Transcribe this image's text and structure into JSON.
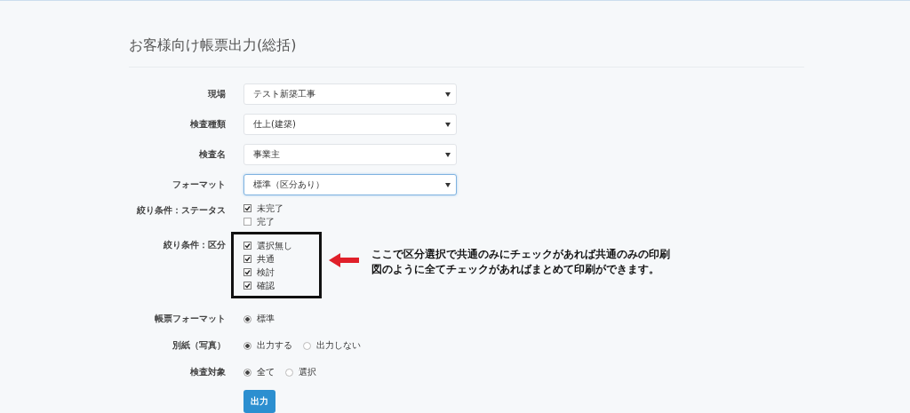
{
  "title": "お客様向け帳票出力(総括)",
  "fields": [
    {
      "kind": "select",
      "label": "現場",
      "value": "テスト新築工事",
      "focused": false
    },
    {
      "kind": "select",
      "label": "検査種類",
      "value": "仕上(建築)",
      "focused": false
    },
    {
      "kind": "select",
      "label": "検査名",
      "value": "事業主",
      "focused": false
    },
    {
      "kind": "select",
      "label": "フォーマット",
      "value": "標準（区分あり）",
      "focused": true
    },
    {
      "kind": "checkboxes",
      "label": "絞り条件：ステータス",
      "highlighted": false,
      "options": [
        {
          "label": "未完了",
          "checked": true
        },
        {
          "label": "完了",
          "checked": false
        }
      ]
    },
    {
      "kind": "checkboxes",
      "label": "絞り条件：区分",
      "highlighted": true,
      "options": [
        {
          "label": "選択無し",
          "checked": true
        },
        {
          "label": "共通",
          "checked": true
        },
        {
          "label": "検討",
          "checked": true
        },
        {
          "label": "確認",
          "checked": true
        }
      ],
      "note": [
        "ここで区分選択で共通のみにチェックがあれば共通のみの印刷",
        "図のように全てチェックがあればまとめて印刷ができます。"
      ]
    },
    {
      "kind": "radios",
      "label": "帳票フォーマット",
      "options": [
        {
          "label": "標準",
          "selected": true
        }
      ]
    },
    {
      "kind": "radios",
      "label": "別紙（写真）",
      "options": [
        {
          "label": "出力する",
          "selected": true
        },
        {
          "label": "出力しない",
          "selected": false
        }
      ]
    },
    {
      "kind": "radios",
      "label": "検査対象",
      "options": [
        {
          "label": "全て",
          "selected": true
        },
        {
          "label": "選択",
          "selected": false
        }
      ]
    }
  ],
  "submit": "出力"
}
